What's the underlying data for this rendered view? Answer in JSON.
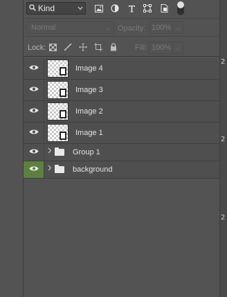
{
  "filter": {
    "kind_label": "Kind",
    "icons": [
      "search-icon",
      "image-filter-icon",
      "adjustment-filter-icon",
      "type-filter-icon",
      "shape-filter-icon",
      "smart-object-filter-icon",
      "filter-toggle"
    ]
  },
  "blend": {
    "mode": "Normal",
    "opacity_label": "Opacity:",
    "opacity_value": "100%"
  },
  "lock": {
    "label": "Lock:",
    "fill_label": "Fill:",
    "fill_value": "100%",
    "icons": [
      "lock-transparent-pixels-icon",
      "lock-image-pixels-icon",
      "lock-position-icon",
      "lock-artboard-icon",
      "lock-all-icon"
    ]
  },
  "layers": [
    {
      "name": "Image 4",
      "type": "image",
      "visible": true,
      "selected": false
    },
    {
      "name": "Image 3",
      "type": "image",
      "visible": true,
      "selected": false
    },
    {
      "name": "Image 2",
      "type": "image",
      "visible": true,
      "selected": false
    },
    {
      "name": "Image 1",
      "type": "image",
      "visible": true,
      "selected": false
    },
    {
      "name": "Group 1",
      "type": "group",
      "visible": true,
      "selected": false
    },
    {
      "name": "background",
      "type": "group",
      "visible": true,
      "selected": true
    }
  ],
  "colors": {
    "panel_bg": "#535353",
    "layer_row_bg": "#4f4f4f",
    "active_eye_bg": "#5d8040"
  },
  "right_edge_digits": [
    "2",
    "2",
    "2"
  ]
}
